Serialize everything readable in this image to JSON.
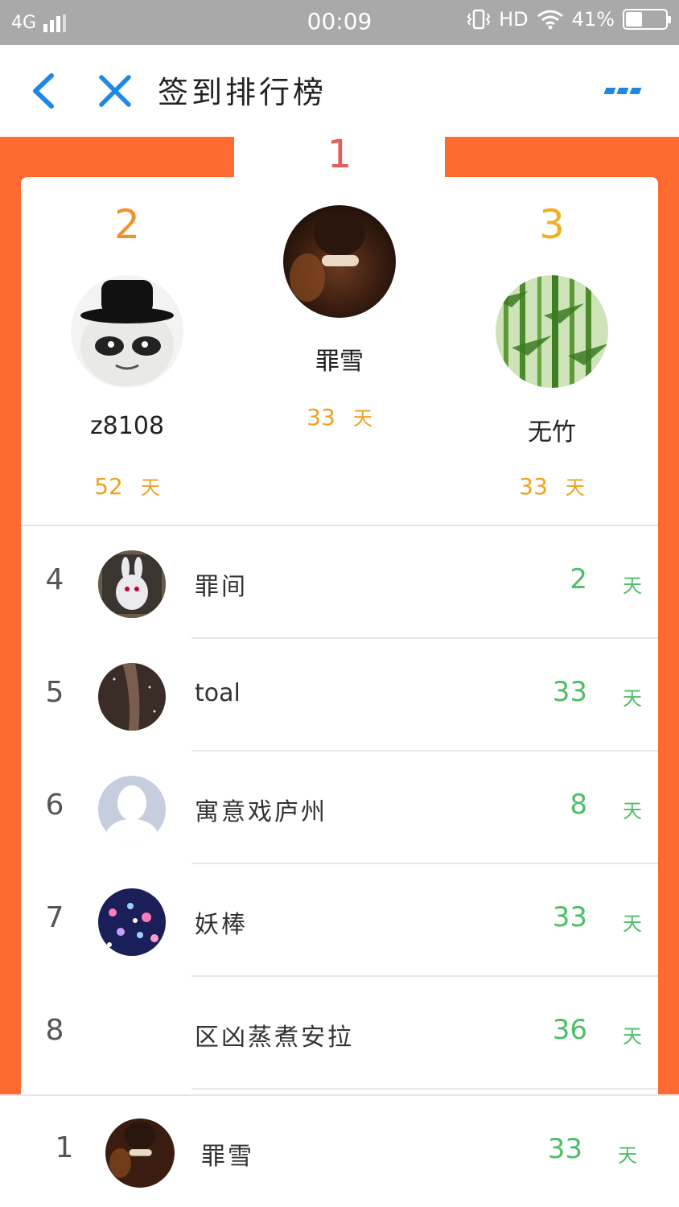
{
  "status_bar": {
    "network": "4G",
    "time": "00:09",
    "hd": "HD",
    "battery": "41%",
    "battery_level": 0.41,
    "icons": [
      "signal-icon",
      "vibrate-icon",
      "wifi-icon",
      "battery-icon"
    ]
  },
  "nav": {
    "title": "签到排行榜",
    "back_icon": "chevron-left-icon",
    "close_icon": "close-icon",
    "more_icon": "more-icon",
    "accent": "#1e88e5"
  },
  "colors": {
    "backdrop": "#ff6a33",
    "rank1": "#e8595a",
    "rank2": "#f0922e",
    "rank3": "#f0b020",
    "podium_days": "#f0a020",
    "list_days": "#4cbe66"
  },
  "podium": {
    "first": {
      "rank": "1",
      "name": "罪雪",
      "days": "33",
      "unit": "天"
    },
    "second": {
      "rank": "2",
      "name": "z8108",
      "days": "52",
      "unit": "天"
    },
    "third": {
      "rank": "3",
      "name": "无竹",
      "days": "33",
      "unit": "天"
    }
  },
  "list": [
    {
      "rank": "4",
      "name": "罪间",
      "days": "2",
      "unit": "天"
    },
    {
      "rank": "5",
      "name": "toal",
      "days": "33",
      "unit": "天"
    },
    {
      "rank": "6",
      "name": "寓意戏庐州",
      "days": "8",
      "unit": "天"
    },
    {
      "rank": "7",
      "name": "妖棒",
      "days": "33",
      "unit": "天"
    },
    {
      "rank": "8",
      "name": "区凶蒸煮安拉",
      "days": "36",
      "unit": "天"
    }
  ],
  "me": {
    "rank": "1",
    "name": "罪雪",
    "days": "33",
    "unit": "天"
  }
}
